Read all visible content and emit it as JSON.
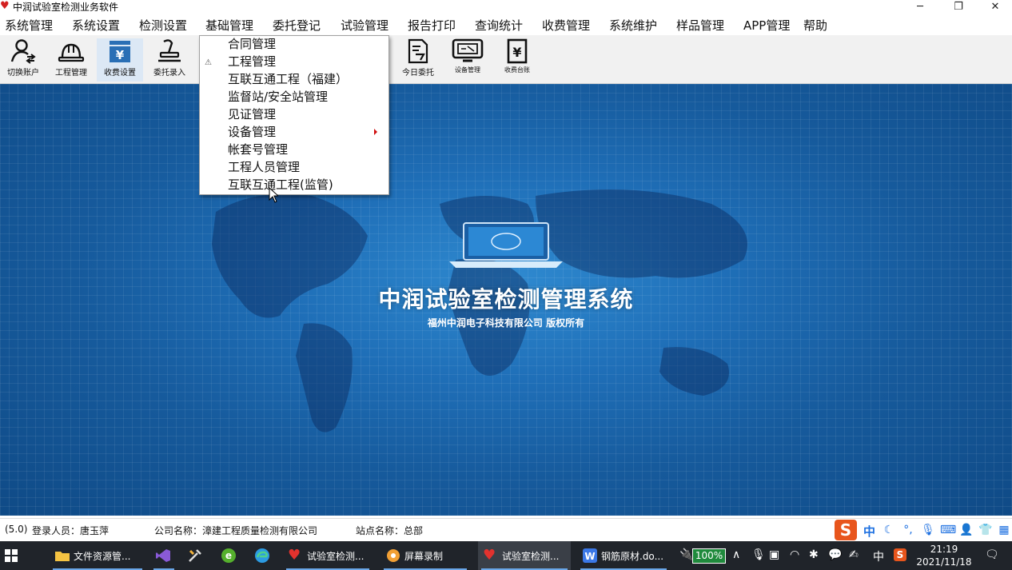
{
  "window": {
    "title": "中润试验室检测业务软件",
    "controls": {
      "minimize": "─",
      "maximize": "❐",
      "close": "✕"
    }
  },
  "menubar": [
    "系统管理",
    "系统设置",
    "检测设置",
    "基础管理",
    "委托登记",
    "试验管理",
    "报告打印",
    "查询统计",
    "收费管理",
    "系统维护",
    "样品管理",
    "APP管理",
    "帮助"
  ],
  "toolbar": {
    "switch_account": "切换账户",
    "project_manage": "工程管理",
    "fee_settings": "收费设置",
    "entrust_entry": "委托录入",
    "today_entrust": "今日委托",
    "device_manage": "设备管理",
    "fee_ledger": "收费台账",
    "fee_symbol": "¥"
  },
  "dropdown": {
    "items": [
      "合同管理",
      "工程管理",
      "互联互通工程（福建）",
      "监督站/安全站管理",
      "见证管理",
      "设备管理",
      "帐套号管理",
      "工程人员管理",
      "互联互通工程(监管)"
    ],
    "side_icon": "⚠"
  },
  "splash": {
    "title": "中润试验室检测管理系统",
    "subtitle": "福州中润电子科技有限公司 版权所有"
  },
  "statusbar": {
    "version": "(5.0)",
    "login": "登录人员：唐玉萍",
    "company": "公司名称：漳建工程质量检测有限公司",
    "station": "站点名称：总部"
  },
  "ime": {
    "logo": "S",
    "lang": "中"
  },
  "taskbar": {
    "apps": [
      {
        "label": "文件资源管..."
      },
      {
        "label": "试验室检测..."
      },
      {
        "label": "屏幕录制"
      },
      {
        "label": "试验室检测..."
      },
      {
        "label": "钢筋原材.do..."
      }
    ],
    "battery": "100%",
    "lang": "中",
    "time": "21:19",
    "date": "2021/11/18"
  },
  "colors": {
    "desktop_bg": "#165a9c",
    "accent_blue": "#1c6fe0",
    "taskbar": "#20242a",
    "ime_orange": "#e8551c"
  }
}
